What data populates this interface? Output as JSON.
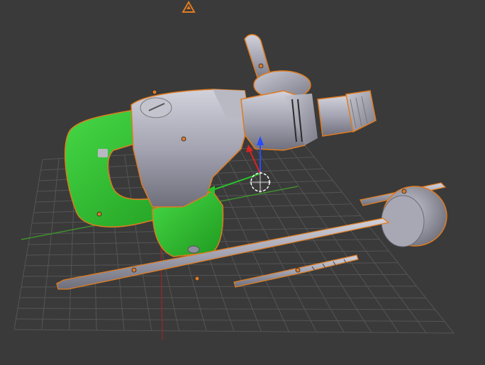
{
  "viewport": {
    "background": "#3a3a3a",
    "grid_color": "#555555",
    "x_axis_color": "#3f8f2f",
    "y_axis_color": "#8a2a2a",
    "selection_outline": "#e07b1e",
    "origin_dot": "#d97a2b"
  },
  "objects": [
    {
      "name": "rotary-hammer-body",
      "material_color": "#a7a7b4",
      "selected": true
    },
    {
      "name": "handle",
      "material_color": "#2fbf2f",
      "selected": true
    },
    {
      "name": "chisel-bit",
      "material_color": "#a7a7b4",
      "selected": true
    },
    {
      "name": "drill-bit",
      "material_color": "#a7a7b4",
      "selected": true
    },
    {
      "name": "core-bit",
      "material_color": "#a7a7b4",
      "selected": true
    }
  ],
  "icons": {
    "camera": "camera-icon",
    "cursor_3d": "3d-cursor-icon",
    "transform_gizmo": "translate-gizmo-icon"
  }
}
